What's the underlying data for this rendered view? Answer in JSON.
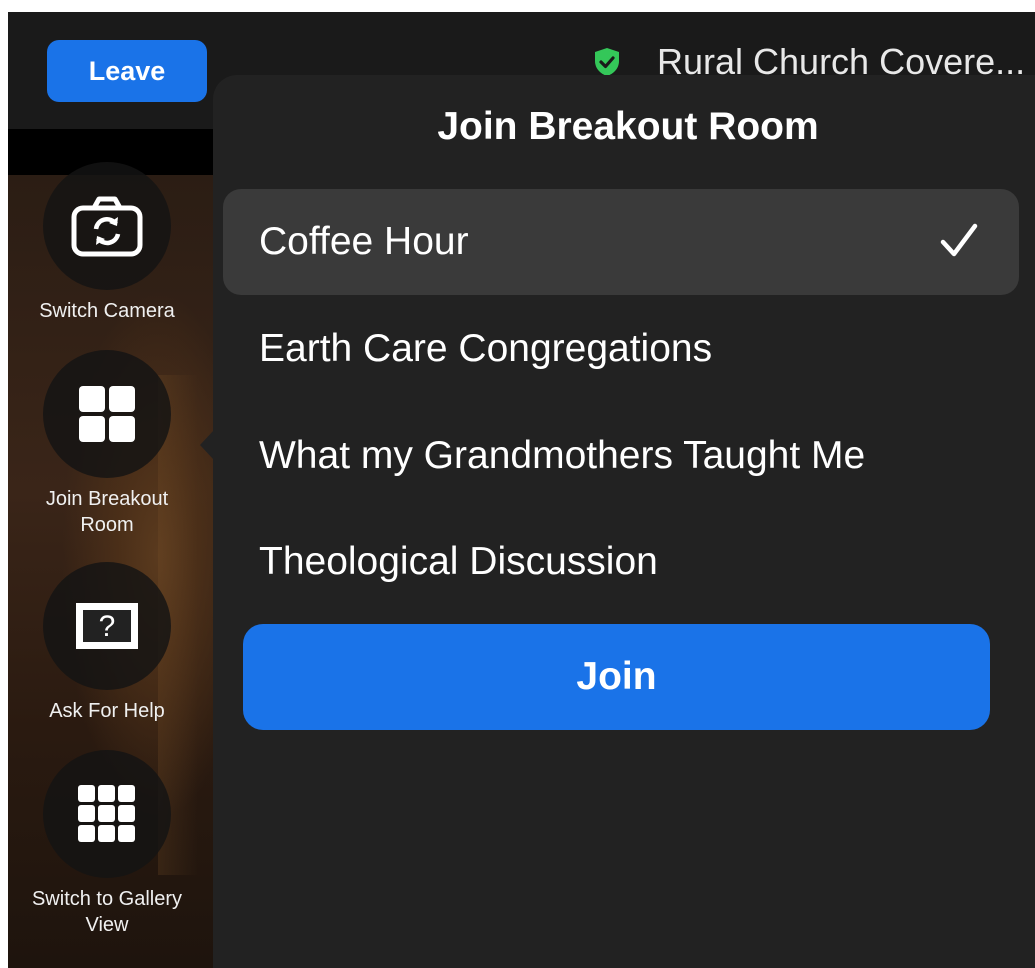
{
  "topbar": {
    "leave_label": "Leave",
    "meeting_title": "Rural Church Covere...",
    "shield_color": "#34c759"
  },
  "controls": [
    {
      "label": "Switch Camera",
      "icon": "switch-camera-icon"
    },
    {
      "label": "Join Breakout Room",
      "icon": "breakout-room-icon"
    },
    {
      "label": "Ask For Help",
      "icon": "ask-for-help-icon"
    },
    {
      "label": "Switch to Gallery View",
      "icon": "gallery-view-icon"
    }
  ],
  "popover": {
    "title": "Join Breakout Room",
    "rooms": [
      {
        "name": "Coffee Hour",
        "selected": true
      },
      {
        "name": "Earth Care Congregations",
        "selected": false
      },
      {
        "name": "What my Grandmothers Taught Me",
        "selected": false
      },
      {
        "name": "Theological Discussion",
        "selected": false
      }
    ],
    "join_label": "Join"
  },
  "colors": {
    "accent": "#1a73e8",
    "popover_bg": "#222222",
    "selected_row": "#3a3a3a"
  }
}
